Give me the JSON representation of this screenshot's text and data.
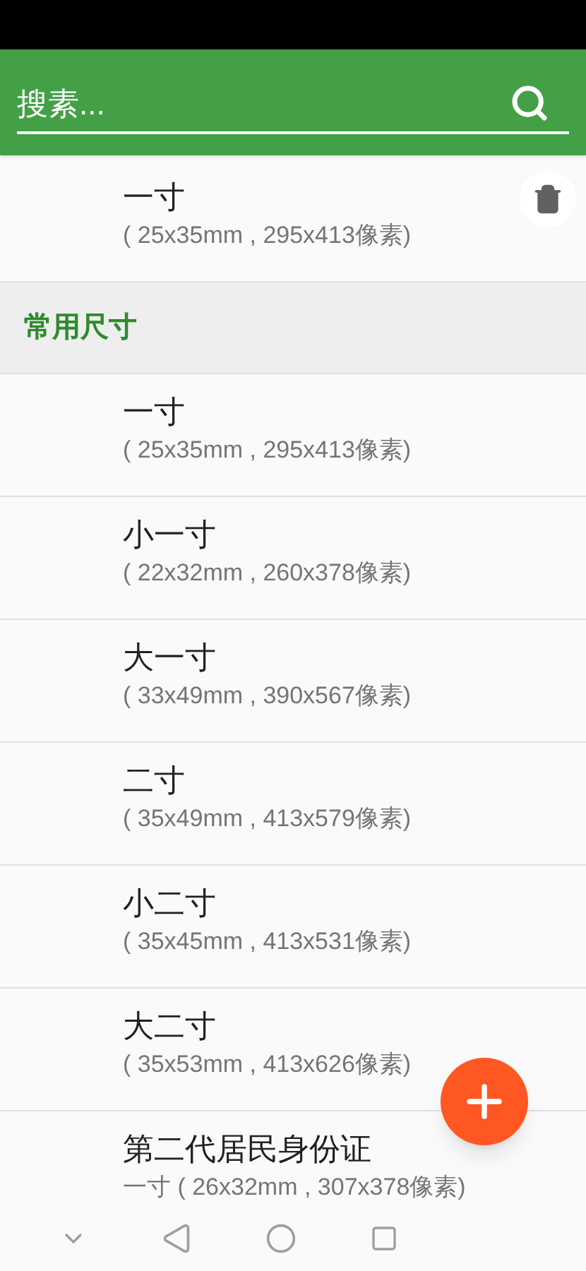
{
  "search": {
    "placeholder": "搜素..."
  },
  "recent": [
    {
      "title": "一寸",
      "subtitle": "( 25x35mm , 295x413像素)"
    }
  ],
  "section": {
    "title": "常用尺寸"
  },
  "sizes": [
    {
      "title": "一寸",
      "subtitle": "( 25x35mm , 295x413像素)"
    },
    {
      "title": "小一寸",
      "subtitle": "( 22x32mm , 260x378像素)"
    },
    {
      "title": "大一寸",
      "subtitle": "( 33x49mm , 390x567像素)"
    },
    {
      "title": "二寸",
      "subtitle": "( 35x49mm , 413x579像素)"
    },
    {
      "title": "小二寸",
      "subtitle": "( 35x45mm , 413x531像素)"
    },
    {
      "title": "大二寸",
      "subtitle": "( 35x53mm , 413x626像素)"
    },
    {
      "title": "第二代居民身份证",
      "subtitle": "一寸 ( 26x32mm , 307x378像素)"
    }
  ]
}
